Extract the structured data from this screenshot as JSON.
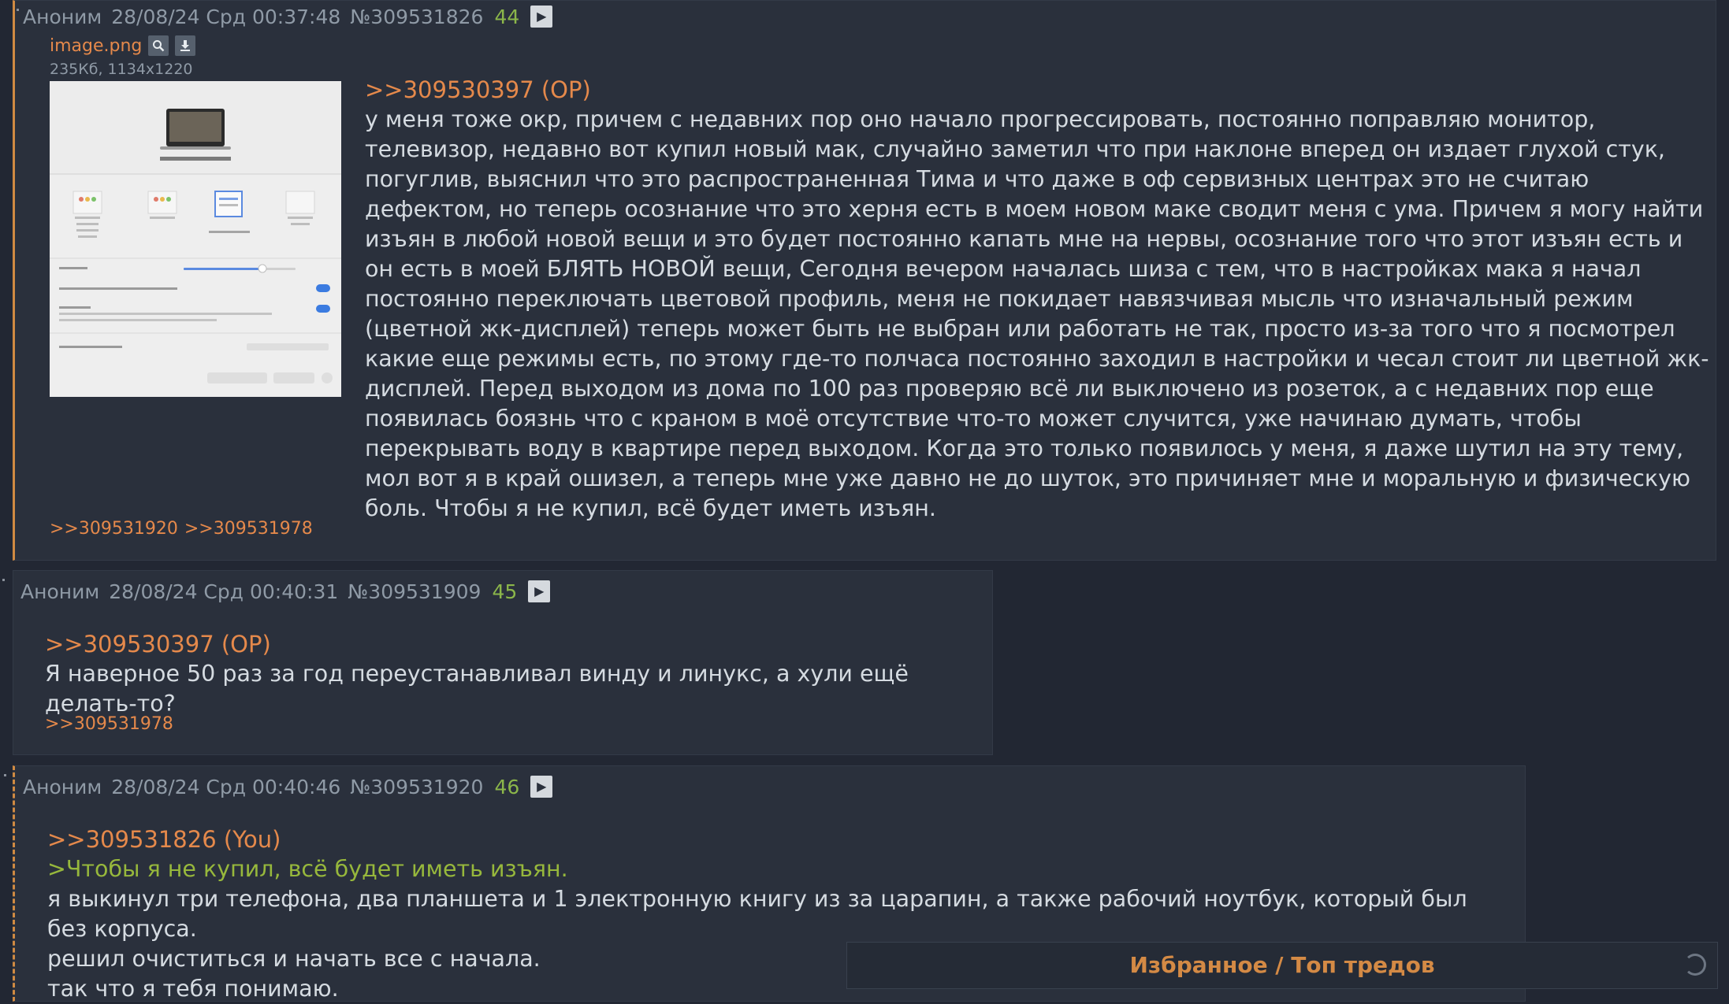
{
  "posts": [
    {
      "name": "Аноним",
      "date": "28/08/24 Срд 00:37:48",
      "id": "№309531826",
      "num": "44",
      "file": {
        "name": "image.png",
        "meta": "235Кб, 1134x1220"
      },
      "reply": ">>309530397 (OP)",
      "text": "у меня тоже окр, причем с недавних пор оно начало прогрессировать, постоянно поправляю монитор, телевизор, недавно вот купил новый мак, случайно заметил что при наклоне вперед он издает глухой стук, погуглив, выяснил что это распространенная Тима и что даже в оф сервизных центрах это не считаю дефектом, но теперь осознание что это херня есть в моем новом маке сводит меня с ума. Причем я могу найти изъян в любой новой вещи и это будет постоянно капать мне на нервы, осознание того что этот изъян есть и он есть в моей БЛЯТЬ НОВОЙ вещи, Сегодня вечером началась шиза с тем, что в настройках мака я начал постоянно переключать цветовой профиль, меня не покидает навязчивая мысль что изначальный режим (цветной жк-дисплей) теперь может быть не выбран или работать не так, просто из-за того что я посмотрел какие еще режимы есть, по этому где-то полчаса постоянно заходил в настройки и чесал стоит ли цветной жк-дисплей. Перед выходом из дома по 100 раз проверяю всё ли выключено из розеток, а с недавних пор еще появилась боязнь что с краном в моё отсутствие что-то может случится, уже начинаю думать, чтобы перекрывать воду в квартире перед выходом. Когда это только появилось у меня, я даже шутил на эту тему, мол вот я в край ошизел, а теперь мне уже давно не до шуток, это причиняет мне и моральную и физическую боль. Чтобы я не купил, всё будет иметь изъян.",
      "backlinks": [
        ">>309531920",
        ">>309531978"
      ]
    },
    {
      "name": "Аноним",
      "date": "28/08/24 Срд 00:40:31",
      "id": "№309531909",
      "num": "45",
      "reply": ">>309530397 (OP)",
      "text": "Я наверное 50 раз за год переустанавливал винду и линукс, а хули ещё делать-то?",
      "backlinks": [
        ">>309531978"
      ]
    },
    {
      "name": "Аноним",
      "date": "28/08/24 Срд 00:40:46",
      "id": "№309531920",
      "num": "46",
      "reply": ">>309531826 (You)",
      "quote": ">Чтобы я не купил, всё будет иметь изъян.",
      "lines": [
        "я выкинул три телефона, два планшета и 1 электронную книгу из за царапин, а также рабочий ноутбук, который был без корпуса.",
        "решил очиститься и начать все с начала.",
        "так что я тебя понимаю."
      ]
    }
  ],
  "bottom_panel": {
    "title": "Избранное / Топ тредов"
  },
  "colors": {
    "accent": "#e5894b",
    "count": "#8bb64a",
    "greentext": "#97b83c",
    "background": "#222733"
  }
}
